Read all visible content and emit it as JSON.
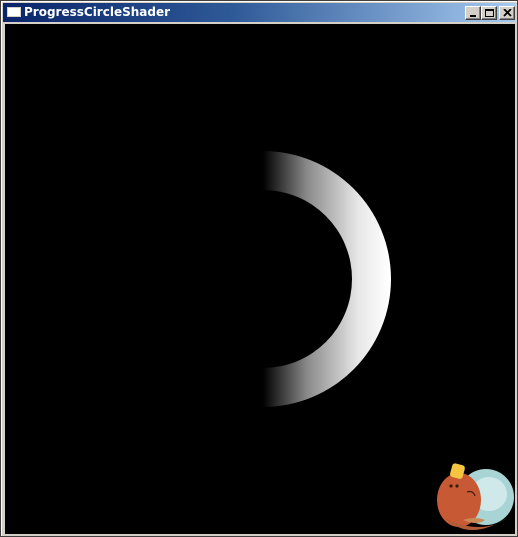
{
  "window": {
    "title": "ProgressCircleShader",
    "controls": {
      "minimize": "minimize-button",
      "maximize": "maximize-button",
      "close": "close-button"
    }
  },
  "shader": {
    "background_color": "#000000",
    "ring_color": "#ffffff",
    "progress_fraction": 0.5
  },
  "decorations": {
    "corner_mascot_icon": "platypus-mascot-icon"
  }
}
